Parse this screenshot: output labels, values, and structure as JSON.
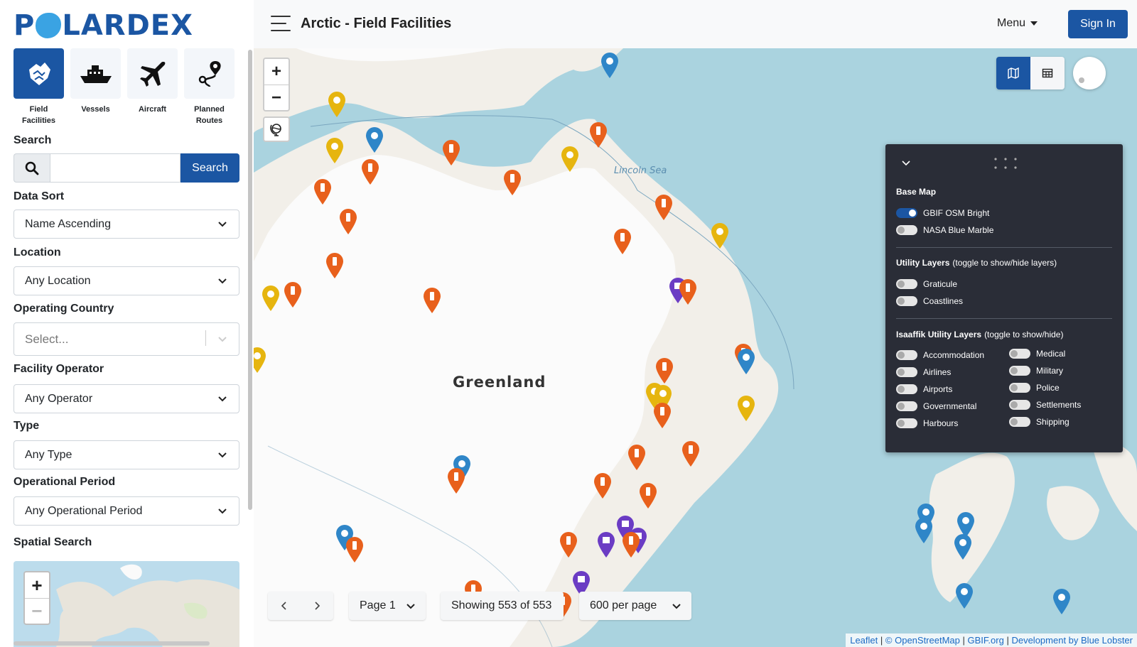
{
  "app": {
    "logo_text": "POLARDEX",
    "title": "Arctic - Field Facilities"
  },
  "header": {
    "menu_label": "Menu",
    "signin_label": "Sign In"
  },
  "categories": [
    {
      "label": "Field Facilities",
      "icon": "field-facilities-icon",
      "active": true
    },
    {
      "label": "Vessels",
      "icon": "vessel-icon",
      "active": false
    },
    {
      "label": "Aircraft",
      "icon": "aircraft-icon",
      "active": false
    },
    {
      "label": "Planned Routes",
      "icon": "route-icon",
      "active": false
    }
  ],
  "filters": {
    "search_label": "Search",
    "search_value": "",
    "search_button": "Search",
    "sort_label": "Data Sort",
    "sort_value": "Name Ascending",
    "location_label": "Location",
    "location_value": "Any Location",
    "country_label": "Operating Country",
    "country_placeholder": "Select...",
    "operator_label": "Facility Operator",
    "operator_value": "Any Operator",
    "type_label": "Type",
    "type_value": "Any Type",
    "period_label": "Operational Period",
    "period_value": "Any Operational Period",
    "spatial_label": "Spatial Search"
  },
  "map": {
    "region_label": "Greenland",
    "sea_label": "Lincoln Sea",
    "zoom_in": "+",
    "zoom_out": "−"
  },
  "layer_panel": {
    "base_map_heading": "Base Map",
    "base_maps": [
      {
        "label": "GBIF OSM Bright",
        "on": true
      },
      {
        "label": "NASA Blue Marble",
        "on": false
      }
    ],
    "utility_heading": "Utility Layers",
    "utility_hint": "(toggle to show/hide layers)",
    "utility_layers": [
      {
        "label": "Graticule",
        "on": false
      },
      {
        "label": "Coastlines",
        "on": false
      }
    ],
    "isaaffik_heading": "Isaaffik Utility Layers",
    "isaaffik_hint": "(toggle to show/hide)",
    "isaaffik_left": [
      {
        "label": "Accommodation",
        "on": false
      },
      {
        "label": "Airlines",
        "on": false
      },
      {
        "label": "Airports",
        "on": false
      },
      {
        "label": "Governmental",
        "on": false
      },
      {
        "label": "Harbours",
        "on": false
      }
    ],
    "isaaffik_right": [
      {
        "label": "Medical",
        "on": false
      },
      {
        "label": "Military",
        "on": false
      },
      {
        "label": "Police",
        "on": false
      },
      {
        "label": "Settlements",
        "on": false
      },
      {
        "label": "Shipping",
        "on": false
      }
    ]
  },
  "pagination": {
    "page_label": "Page 1",
    "showing": "Showing 553 of 553",
    "per_page": "600 per page"
  },
  "attribution": {
    "leaflet": "Leaflet",
    "sep": "|",
    "osm": "© OpenStreetMap",
    "gbif": "GBIF.org",
    "dev": "Development by Blue Lobster"
  },
  "colors": {
    "brand": "#1b56a3",
    "pin_orange": "#e8601c",
    "pin_yellow": "#e6b50f",
    "pin_blue": "#2f86c8",
    "pin_purple": "#6b3cc4",
    "sea": "#aad3df",
    "land": "#f2efe9",
    "ice": "#fbfbfb"
  }
}
